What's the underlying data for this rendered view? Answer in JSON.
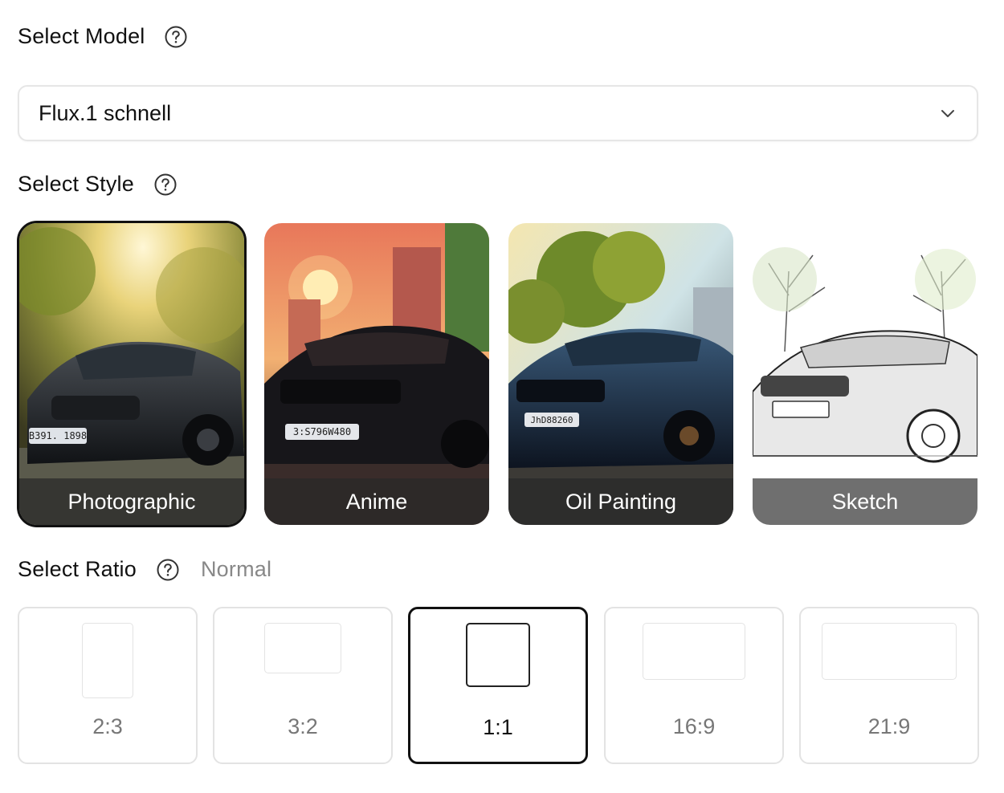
{
  "model": {
    "label": "Select Model",
    "selected": "Flux.1 schnell"
  },
  "style": {
    "label": "Select Style",
    "options": [
      {
        "label": "Photographic",
        "plate": "B391. 1898",
        "selected": true
      },
      {
        "label": "Anime",
        "plate": "3:S796W480",
        "selected": false
      },
      {
        "label": "Oil Painting",
        "plate": "JhD88260",
        "selected": false
      },
      {
        "label": "Sketch",
        "selected": false
      }
    ]
  },
  "ratio": {
    "label": "Select Ratio",
    "mode": "Normal",
    "options": [
      {
        "label": "2:3",
        "selected": false
      },
      {
        "label": "3:2",
        "selected": false
      },
      {
        "label": "1:1",
        "selected": true
      },
      {
        "label": "16:9",
        "selected": false
      },
      {
        "label": "21:9",
        "selected": false
      }
    ]
  },
  "icons": {
    "help": "question-circle-icon",
    "dropdown": "chevron-down-icon"
  },
  "colors": {
    "selected_border": "#111111",
    "card_border": "#e3e3e3",
    "muted_text": "#888888"
  }
}
